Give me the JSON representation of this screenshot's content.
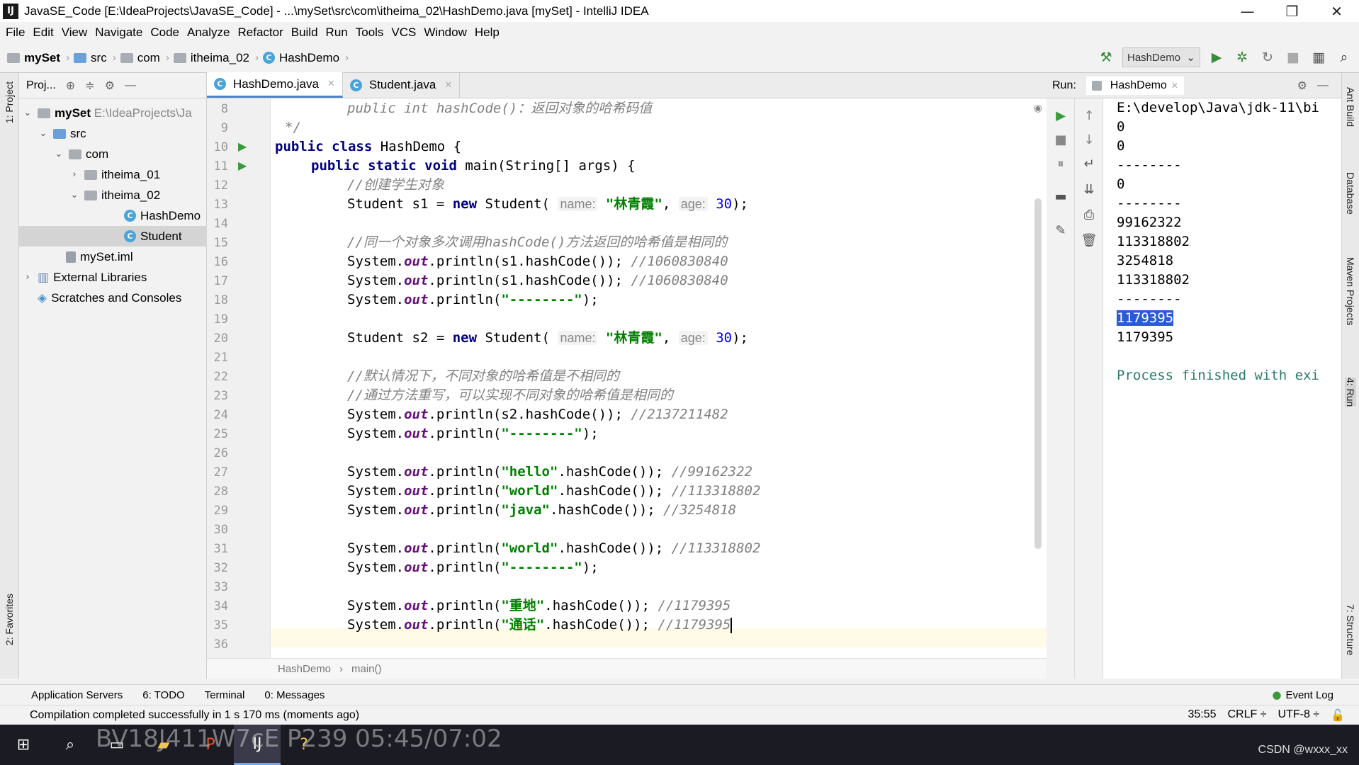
{
  "window": {
    "title": "JavaSE_Code [E:\\IdeaProjects\\JavaSE_Code] - ...\\mySet\\src\\com\\itheima_02\\HashDemo.java [mySet] - IntelliJ IDEA",
    "app_icon": "IJ",
    "minimize": "—",
    "maximize": "❐",
    "close": "✕"
  },
  "menu": [
    "File",
    "Edit",
    "View",
    "Navigate",
    "Code",
    "Analyze",
    "Refactor",
    "Build",
    "Run",
    "Tools",
    "VCS",
    "Window",
    "Help"
  ],
  "breadcrumbs": [
    "mySet",
    "src",
    "com",
    "itheima_02",
    "HashDemo"
  ],
  "toolbar": {
    "run_config": "HashDemo"
  },
  "left_strip": {
    "project_tab": "1: Project",
    "favorites_tab": "2: Favorites"
  },
  "project_panel": {
    "header_label": "Proj...",
    "tree": [
      {
        "label": "mySet",
        "extra": "E:\\IdeaProjects\\Ja",
        "arrow": "⌄"
      },
      {
        "label": "src",
        "arrow": "⌄"
      },
      {
        "label": "com",
        "arrow": "⌄"
      },
      {
        "label": "itheima_01",
        "arrow": "›"
      },
      {
        "label": "itheima_02",
        "arrow": "⌄"
      },
      {
        "label": "HashDemo"
      },
      {
        "label": "Student"
      },
      {
        "label": "mySet.iml"
      },
      {
        "label": "External Libraries",
        "arrow": "›"
      },
      {
        "label": "Scratches and Consoles"
      }
    ]
  },
  "editor": {
    "tabs": [
      {
        "label": "HashDemo.java",
        "active": true
      },
      {
        "label": "Student.java",
        "active": false
      }
    ],
    "line_numbers": [
      "8",
      "9",
      "10",
      "11",
      "12",
      "13",
      "14",
      "15",
      "16",
      "17",
      "18",
      "19",
      "20",
      "21",
      "22",
      "23",
      "24",
      "25",
      "26",
      "27",
      "28",
      "29",
      "30",
      "31",
      "32",
      "33",
      "34",
      "35",
      "36"
    ],
    "code": {
      "l8_a": "public int hashCode()",
      "l8_b": "：返回对象的哈希码值",
      "l9": "*/",
      "l10_kw": "public class",
      "l10_rest": " HashDemo {",
      "l11_kw": "public static void",
      "l11_rest": " main(String[] args) {",
      "l12": "//创建学生对象",
      "l13_a": "Student s1 = ",
      "l13_new": "new",
      "l13_b": " Student( ",
      "l13_hint1": "name:",
      "l13_str": "\"林青霞\"",
      "l13_c": ", ",
      "l13_hint2": "age:",
      "l13_num": "30",
      "l13_d": ");",
      "l15": "//同一个对象多次调用hashCode()方法返回的哈希值是相同的",
      "sys": "System.",
      "out": "out",
      "l16_rest": ".println(s1.hashCode()); ",
      "l16_cmt": "//1060830840",
      "l17_rest": ".println(s1.hashCode()); ",
      "l17_cmt": "//1060830840",
      "println_open": ".println(",
      "dashes": "\"--------\"",
      "close": ");",
      "l20_a": "Student s2 = ",
      "l20_str": "\"林青霞\"",
      "l20_num": "30",
      "l22": "//默认情况下，不同对象的哈希值是不相同的",
      "l23": "//通过方法重写，可以实现不同对象的哈希值是相同的",
      "l24_rest": ".println(s2.hashCode()); ",
      "l24_cmt": "//2137211482",
      "hash_tail": ".hashCode()); ",
      "l27_str": "\"hello\"",
      "l27_cmt": "//99162322",
      "l28_str": "\"world\"",
      "l28_cmt": "//113318802",
      "l29_str": "\"java\"",
      "l29_cmt": "//3254818",
      "l31_str": "\"world\"",
      "l31_cmt": "//113318802",
      "l34_str": "\"重地\"",
      "l34_cmt": "//1179395",
      "l35_str": "\"通话\"",
      "l35_cmt": "//1179395"
    },
    "breadcrumb": [
      "HashDemo",
      "main()"
    ]
  },
  "run_panel": {
    "label": "Run:",
    "tab": "HashDemo",
    "console": [
      "E:\\develop\\Java\\jdk-11\\bi",
      "0",
      "0",
      "--------",
      "0",
      "--------",
      "99162322",
      "113318802",
      "3254818",
      "113318802",
      "--------",
      "1179395",
      "1179395",
      "",
      "Process finished with exi"
    ]
  },
  "right_strip": {
    "ant": "Ant Build",
    "database": "Database",
    "maven": "Maven Projects",
    "run": "4: Run",
    "structure": "7: Structure"
  },
  "bottom_tools": [
    "Application Servers",
    "6: TODO",
    "Terminal",
    "0: Messages"
  ],
  "event_log": "Event Log",
  "status": {
    "message": "Compilation completed successfully in 1 s 170 ms (moments ago)",
    "position": "35:55",
    "line_sep": "CRLF ÷",
    "encoding": "UTF-8 ÷"
  },
  "overlay": "BV18J411W7cE P239 05:45/07:02",
  "watermark": "CSDN @wxxx_xx"
}
